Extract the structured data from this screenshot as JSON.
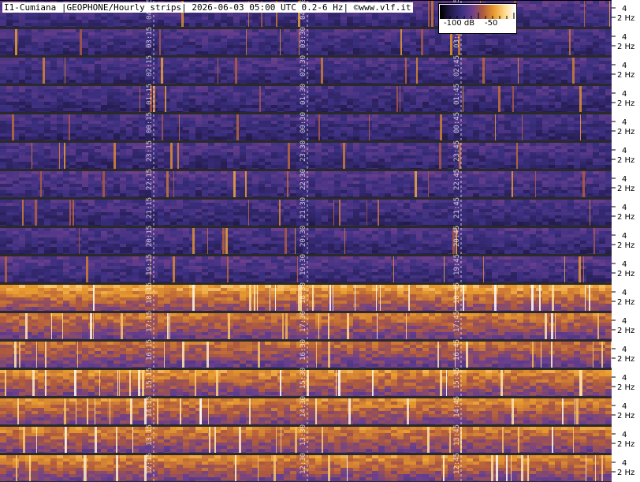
{
  "title": "I1-Cumiana |GEOPHONE/Hourly strips| 2026-06-03 05:00 UTC 0.2-6 Hz| ©www.vlf.it",
  "colorbar": {
    "label_low": "-100 dB",
    "label_high": "-50",
    "colors": [
      "#000000",
      "#231a4a",
      "#3b2f80",
      "#6b3f8e",
      "#b05a3e",
      "#e89a2e",
      "#ffd98a",
      "#ffffff"
    ]
  },
  "chart_data": {
    "type": "heatmap",
    "title": "I1-Cumiana |GEOPHONE/Hourly strips| 2026-06-03 05:00 UTC 0.2-6 Hz| ©www.vlf.it",
    "frequency_range_hz": [
      0.2,
      6
    ],
    "y_ticks": [
      "4",
      "2 Hz"
    ],
    "color_scale_db": [
      -100,
      -50
    ],
    "strips": [
      {
        "labels": [
          "04:15",
          "04:30",
          "04:45"
        ],
        "intensity": 0.3
      },
      {
        "labels": [
          "03:15",
          "03:30",
          "03:45"
        ],
        "intensity": 0.28
      },
      {
        "labels": [
          "02:15",
          "02:30",
          "02:45"
        ],
        "intensity": 0.28
      },
      {
        "labels": [
          "01:15",
          "01:30",
          "01:45"
        ],
        "intensity": 0.27
      },
      {
        "labels": [
          "00:15",
          "00:30",
          "00:45"
        ],
        "intensity": 0.27
      },
      {
        "labels": [
          "23:15",
          "23:30",
          "23:45"
        ],
        "intensity": 0.28
      },
      {
        "labels": [
          "22:15",
          "22:30",
          "22:45"
        ],
        "intensity": 0.3
      },
      {
        "labels": [
          "21:15",
          "21:30",
          "21:45"
        ],
        "intensity": 0.27
      },
      {
        "labels": [
          "20:15",
          "20:30",
          "20:45"
        ],
        "intensity": 0.28
      },
      {
        "labels": [
          "19:15",
          "19:30",
          "19:45"
        ],
        "intensity": 0.3
      },
      {
        "labels": [
          "18:15",
          "18:30",
          "18:45"
        ],
        "intensity": 0.6
      },
      {
        "labels": [
          "17:15",
          "17:30",
          "17:45"
        ],
        "intensity": 0.52
      },
      {
        "labels": [
          "16:15",
          "16:30",
          "16:45"
        ],
        "intensity": 0.5
      },
      {
        "labels": [
          "15:15",
          "15:30",
          "15:45"
        ],
        "intensity": 0.56
      },
      {
        "labels": [
          "14:15",
          "14:30",
          "14:45"
        ],
        "intensity": 0.55
      },
      {
        "labels": [
          "13:15",
          "13:30",
          "13:45"
        ],
        "intensity": 0.54
      },
      {
        "labels": [
          "12:15",
          "12:30",
          "12:45"
        ],
        "intensity": 0.55
      }
    ]
  }
}
